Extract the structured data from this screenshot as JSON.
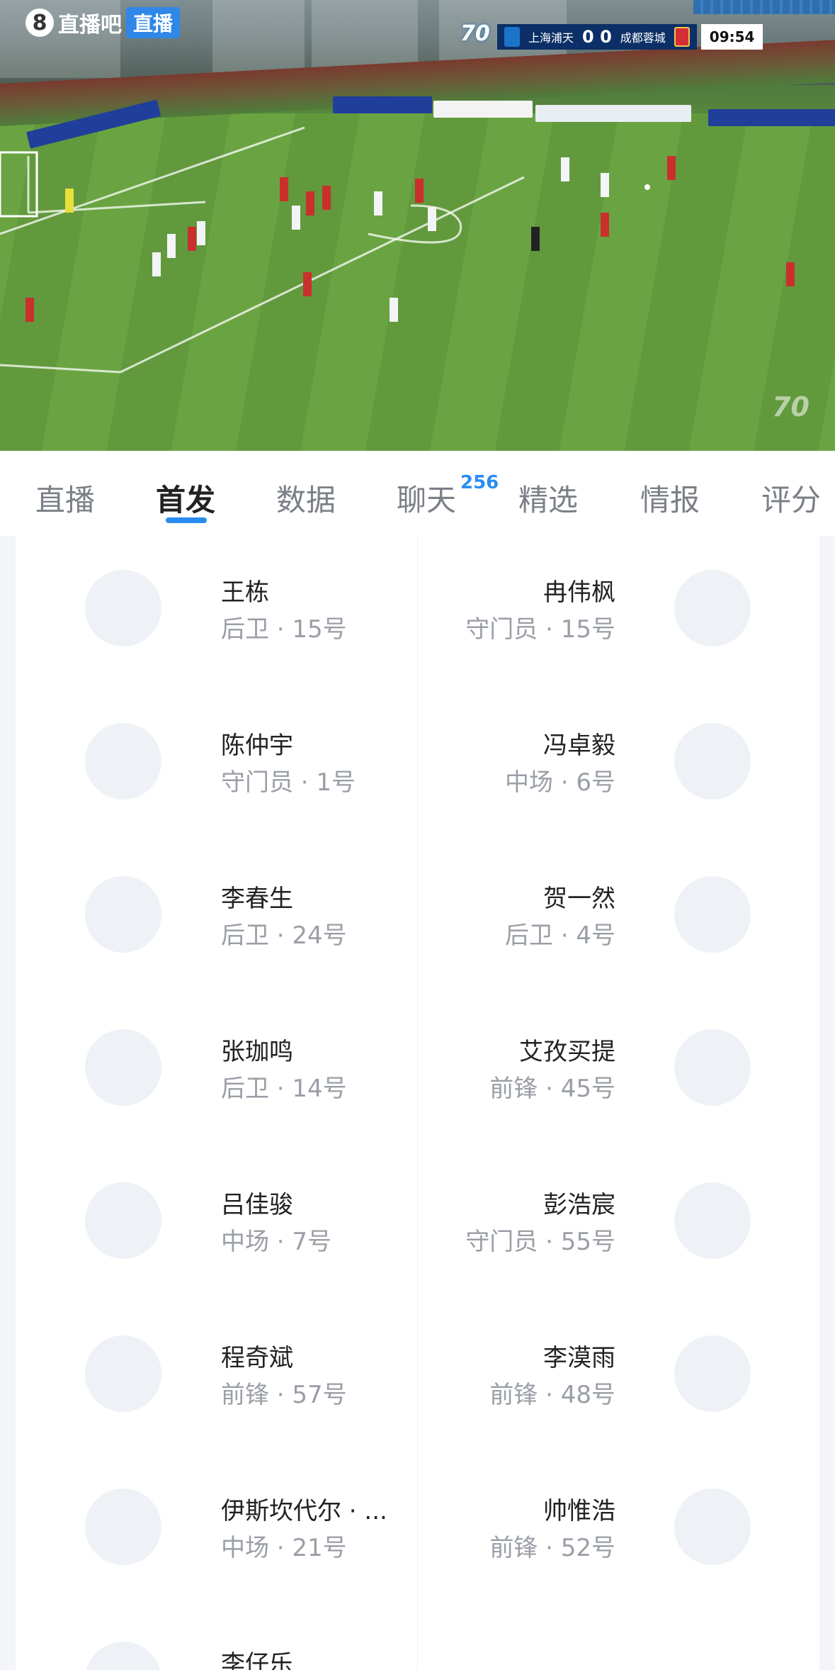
{
  "broadcast": {
    "logo_number": "8",
    "logo_text": "直播吧",
    "logo_badge": "直播",
    "home_team": "上海浦天",
    "score": "0 0",
    "away_team": "成都蓉城",
    "clock": "09:54",
    "anniversary_badge": "70",
    "watermark": "70"
  },
  "tabs": [
    {
      "label": "直播"
    },
    {
      "label": "首发"
    },
    {
      "label": "数据"
    },
    {
      "label": "聊天"
    },
    {
      "label": "精选"
    },
    {
      "label": "情报"
    },
    {
      "label": "评分"
    }
  ],
  "chat_count": "256",
  "lineup": {
    "home": [
      {
        "name": "王栋",
        "info": "后卫 · 15号"
      },
      {
        "name": "陈仲宇",
        "info": "守门员 · 1号"
      },
      {
        "name": "李春生",
        "info": "后卫 · 24号"
      },
      {
        "name": "张珈鸣",
        "info": "后卫 · 14号"
      },
      {
        "name": "吕佳骏",
        "info": "中场 · 7号"
      },
      {
        "name": "程奇斌",
        "info": "前锋 · 57号"
      },
      {
        "name": "伊斯坎代尔 · ...",
        "info": "中场 · 21号"
      },
      {
        "name": "李仔乐",
        "info": ""
      }
    ],
    "away": [
      {
        "name": "冉伟枫",
        "info": "守门员 · 15号"
      },
      {
        "name": "冯卓毅",
        "info": "中场 · 6号"
      },
      {
        "name": "贺一然",
        "info": "后卫 · 4号"
      },
      {
        "name": "艾孜买提",
        "info": "前锋 · 45号"
      },
      {
        "name": "彭浩宸",
        "info": "守门员 · 55号"
      },
      {
        "name": "李漠雨",
        "info": "前锋 · 48号"
      },
      {
        "name": "帅惟浩",
        "info": "前锋 · 52号"
      }
    ]
  },
  "colors": {
    "accent": "#2a8cf0",
    "home_kit": "#c9302c",
    "away_kit": "#f2f4f6"
  }
}
